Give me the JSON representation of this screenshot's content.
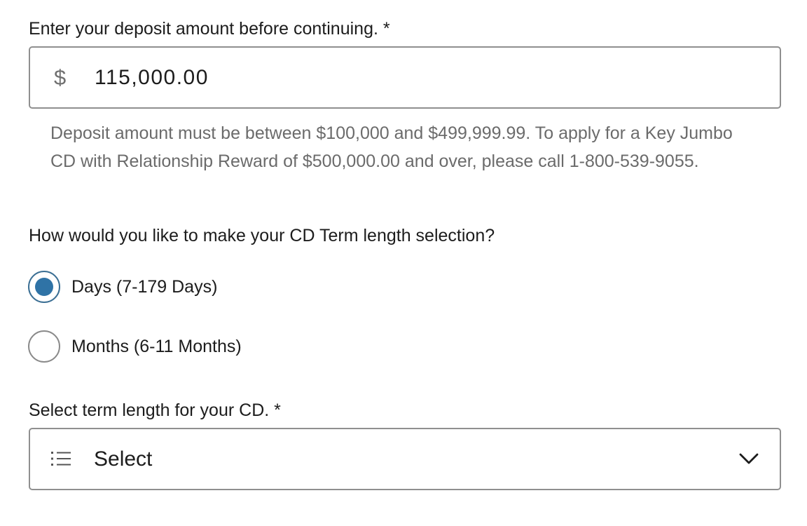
{
  "deposit": {
    "label": "Enter your deposit amount before continuing. *",
    "currency_symbol": "$",
    "value": "115,000.00",
    "help_text": "Deposit amount must be between $100,000 and $499,999.99. To apply for a Key Jumbo CD with Relationship Reward of $500,000.00 and over, please call 1-800-539-9055."
  },
  "term_selection": {
    "question": "How would you like to make your CD Term length selection?",
    "options": [
      {
        "label": "Days (7-179 Days)",
        "selected": true
      },
      {
        "label": "Months (6-11 Months)",
        "selected": false
      }
    ]
  },
  "term_length": {
    "label": "Select term length for your CD. *",
    "selected_value": "Select",
    "icon": "list-icon",
    "dropdown_icon": "chevron-down-icon"
  },
  "colors": {
    "radio_selected": "#2f73a6",
    "border": "#8f8f8f",
    "help_text": "#6b6b6b"
  }
}
